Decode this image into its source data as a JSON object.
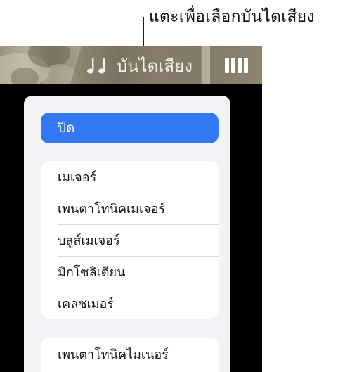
{
  "callout": {
    "text": "แตะเพื่อเลือกบันไดเสียง"
  },
  "toolbar": {
    "scale_label": "บันไดเสียง",
    "scale_icon": "music-notes-icon",
    "keys_icon": "keyboard-keys-icon"
  },
  "menu": {
    "off_label": "ปิด",
    "groups": [
      {
        "items": [
          "เมเจอร์",
          "เพนตาโทนิคเมเจอร์",
          "บลูส์เมเจอร์",
          "มิกโซลิเดียน",
          "เคลซเมอร์"
        ]
      },
      {
        "items": [
          "เพนตาโทนิคไมเนอร์"
        ]
      }
    ]
  },
  "colors": {
    "accent": "#3478f6",
    "panel_bg": "#f2f2f7",
    "backdrop": "#000000"
  }
}
